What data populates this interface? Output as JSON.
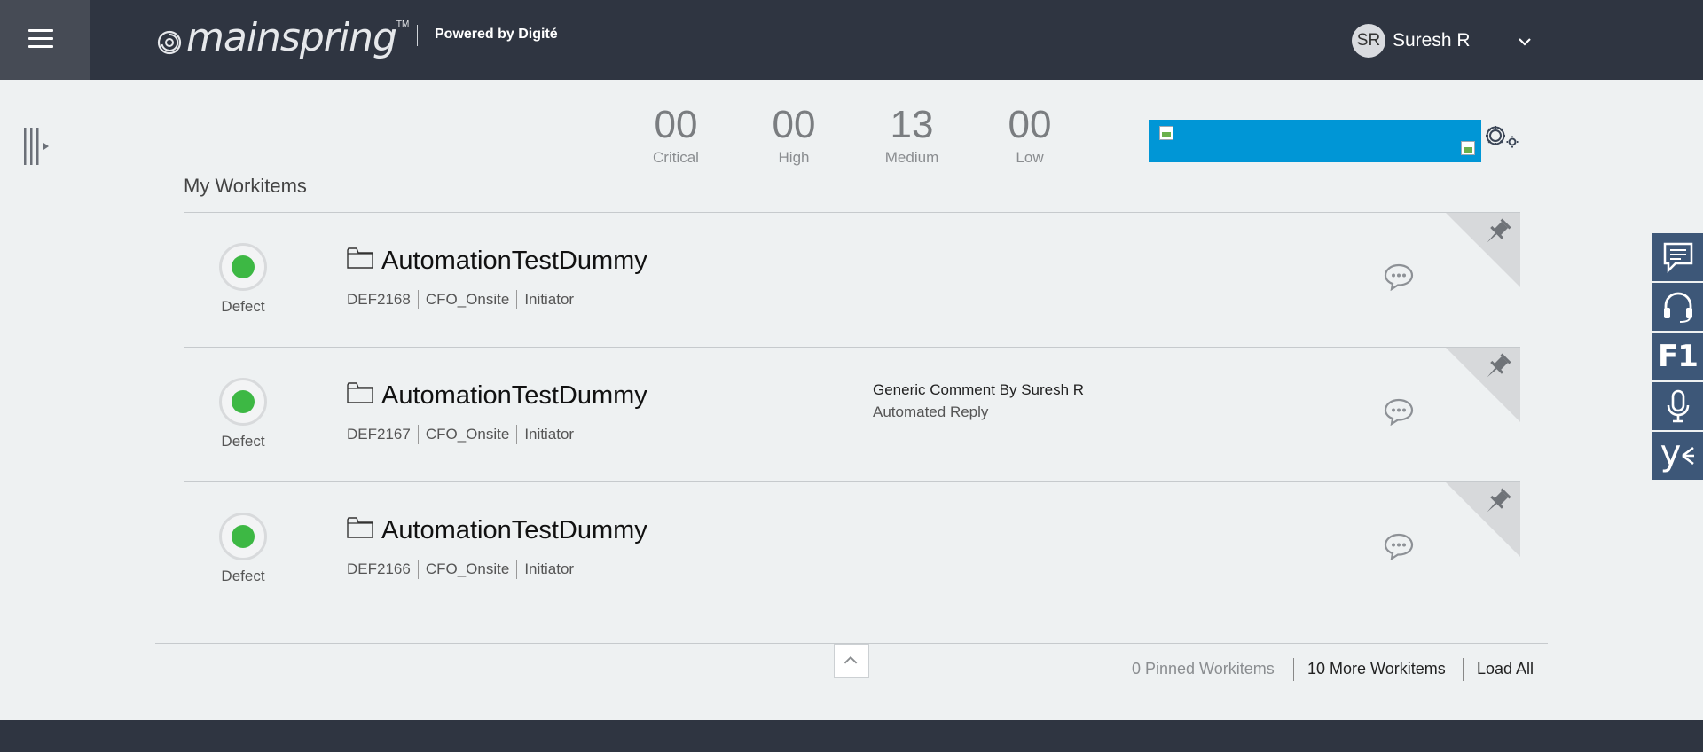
{
  "header": {
    "logo_text": "mainspring",
    "logo_tm": "TM",
    "powered_by": "Powered by Digité",
    "user": {
      "initials": "SR",
      "name": "Suresh R"
    }
  },
  "severity": [
    {
      "count": "00",
      "label": "Critical"
    },
    {
      "count": "00",
      "label": "High"
    },
    {
      "count": "13",
      "label": "Medium"
    },
    {
      "count": "00",
      "label": "Low"
    }
  ],
  "section_title": "My Workitems",
  "workitems": [
    {
      "type": "Defect",
      "title": "AutomationTestDummy",
      "id": "DEF2168",
      "project": "CFO_Onsite",
      "role": "Initiator",
      "comment_by": "",
      "comment_text": ""
    },
    {
      "type": "Defect",
      "title": "AutomationTestDummy",
      "id": "DEF2167",
      "project": "CFO_Onsite",
      "role": "Initiator",
      "comment_by": "Generic Comment By Suresh R",
      "comment_text": "Automated Reply"
    },
    {
      "type": "Defect",
      "title": "AutomationTestDummy",
      "id": "DEF2166",
      "project": "CFO_Onsite",
      "role": "Initiator",
      "comment_by": "",
      "comment_text": ""
    }
  ],
  "footer": {
    "pinned": "0 Pinned Workitems",
    "more": "10 More Workitems",
    "load_all": "Load All"
  },
  "rail": {
    "f1_label": "F1",
    "yammer_label": "y"
  },
  "colors": {
    "topbar": "#2f3541",
    "status_dot": "#3db844",
    "banner": "#0096d6",
    "rail": "#3d5778"
  },
  "icons": [
    "menu-icon",
    "chevron-down-icon",
    "sidebar-toggle-icon",
    "settings-gear-icon",
    "folder-icon",
    "chat-bubble-icon",
    "pin-icon",
    "chevron-up-icon",
    "feedback-icon",
    "headset-icon",
    "microphone-icon",
    "yammer-icon"
  ]
}
